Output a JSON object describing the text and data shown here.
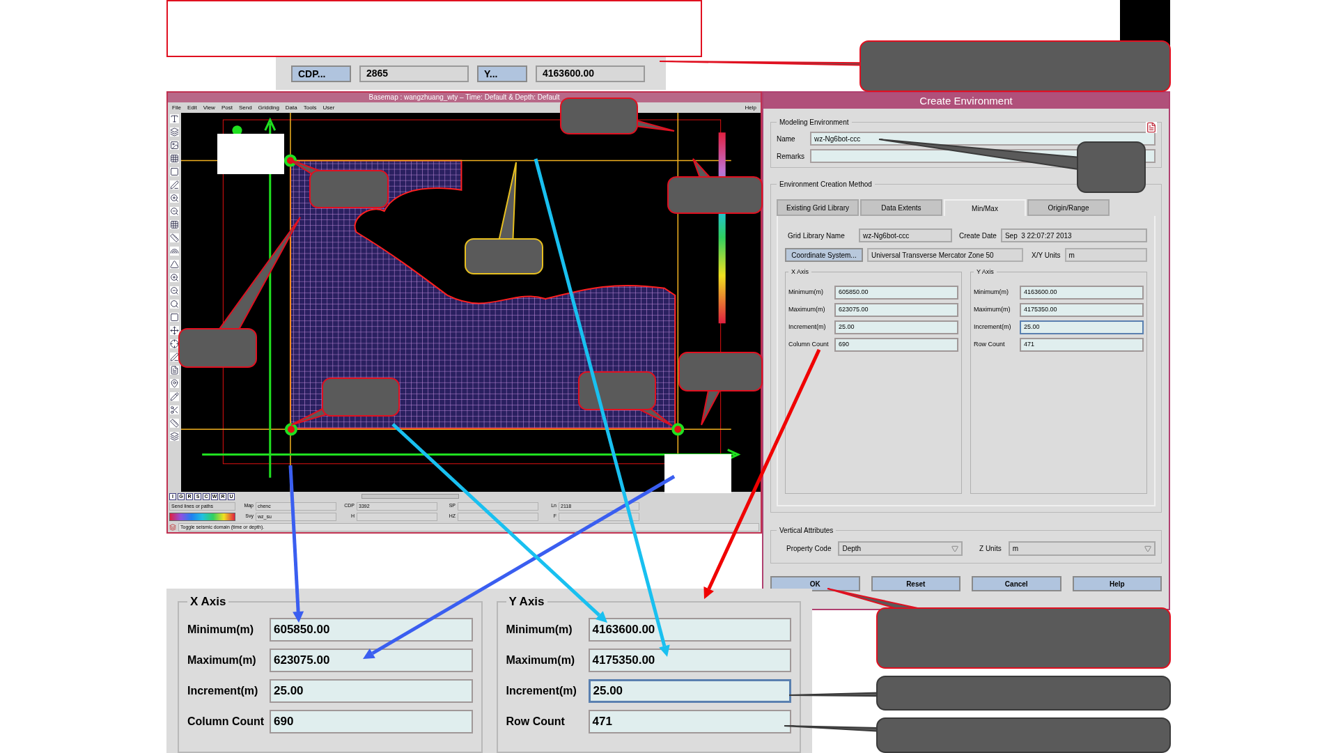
{
  "top_strip": {
    "items": [
      {
        "kind": "button",
        "text": "CDP..."
      },
      {
        "kind": "field",
        "text": "2865"
      },
      {
        "kind": "button",
        "text": "Y..."
      },
      {
        "kind": "field",
        "text": "4163600.00"
      }
    ]
  },
  "basemap": {
    "title": "Basemap : wangzhuang_wty – Time: Default & Depth: Default",
    "menu": [
      "File",
      "Edit",
      "View",
      "Post",
      "Send",
      "Gridding",
      "Data",
      "Tools",
      "User"
    ],
    "help": "Help",
    "tool_row": [
      "I",
      "G",
      "R",
      "S",
      "C",
      "W",
      "R",
      "U"
    ],
    "status_rows": [
      [
        {
          "kind": "text",
          "value": "Send lines or paths"
        },
        {
          "kind": "field",
          "label": "Map",
          "value": "chenc"
        },
        {
          "kind": "field",
          "label": "CDP",
          "value": "3392"
        },
        {
          "kind": "field",
          "label": "SP"
        },
        {
          "kind": "field",
          "label": "Ln",
          "value": "2118"
        }
      ],
      [
        {
          "kind": "colorbar"
        },
        {
          "kind": "field",
          "label": "Svy",
          "value": "wz_su"
        },
        {
          "kind": "field",
          "label": "H"
        },
        {
          "kind": "field",
          "label": "HZ"
        },
        {
          "kind": "field",
          "label": "F"
        }
      ]
    ],
    "message": "Toggle seismic domain (time or depth)."
  },
  "dialog": {
    "title": "Create Environment",
    "modeling": {
      "legend": "Modeling Environment",
      "name_label": "Name",
      "name": "wz-Ng6bot-ccc",
      "remarks_label": "Remarks"
    },
    "method": {
      "legend": "Environment Creation Method",
      "tabs": [
        {
          "label": "Existing Grid Library",
          "selected": false
        },
        {
          "label": "Data Extents",
          "selected": false
        },
        {
          "label": "Min/Max",
          "selected": true
        },
        {
          "label": "Origin/Range",
          "selected": false
        }
      ],
      "grid_library_label": "Grid Library Name",
      "grid_library": "wz-Ng6bot-ccc",
      "create_date_label": "Create Date",
      "create_date": "Sep  3 22:07:27 2013",
      "coord_button": "Coordinate System...",
      "coord_value": "Universal Transverse Mercator Zone 50",
      "units_label": "X/Y Units",
      "units": "m",
      "axes": [
        {
          "legend": "X Axis",
          "rows": [
            {
              "label": "Minimum(m)",
              "value": "605850.00",
              "focused": false
            },
            {
              "label": "Maximum(m)",
              "value": "623075.00",
              "focused": false
            },
            {
              "label": "Increment(m)",
              "value": "25.00",
              "focused": false
            },
            {
              "label": "Column Count",
              "value": "690",
              "focused": false
            }
          ]
        },
        {
          "legend": "Y Axis",
          "rows": [
            {
              "label": "Minimum(m)",
              "value": "4163600.00",
              "focused": false
            },
            {
              "label": "Maximum(m)",
              "value": "4175350.00",
              "focused": false
            },
            {
              "label": "Increment(m)",
              "value": "25.00",
              "focused": true
            },
            {
              "label": "Row Count",
              "value": "471",
              "focused": false
            }
          ]
        }
      ]
    },
    "vertical": {
      "legend": "Vertical Attributes",
      "fields": [
        {
          "label": "Property Code",
          "value": "Depth"
        },
        {
          "label": "Z Units",
          "value": "m"
        }
      ]
    },
    "buttons": [
      "OK",
      "Reset",
      "Cancel",
      "Help"
    ]
  },
  "zoom_panel": {
    "axes": [
      {
        "legend": "X Axis",
        "rows": [
          {
            "label": "Minimum(m)",
            "value": "605850.00",
            "focused": false
          },
          {
            "label": "Maximum(m)",
            "value": "623075.00",
            "focused": false
          },
          {
            "label": "Increment(m)",
            "value": "25.00",
            "focused": false
          },
          {
            "label": "Column Count",
            "value": "690",
            "focused": false
          }
        ]
      },
      {
        "legend": "Y Axis",
        "rows": [
          {
            "label": "Minimum(m)",
            "value": "4163600.00",
            "focused": false
          },
          {
            "label": "Maximum(m)",
            "value": "4175350.00",
            "focused": false
          },
          {
            "label": "Increment(m)",
            "value": "25.00",
            "focused": true
          },
          {
            "label": "Row Count",
            "value": "471",
            "focused": false
          }
        ]
      }
    ]
  }
}
